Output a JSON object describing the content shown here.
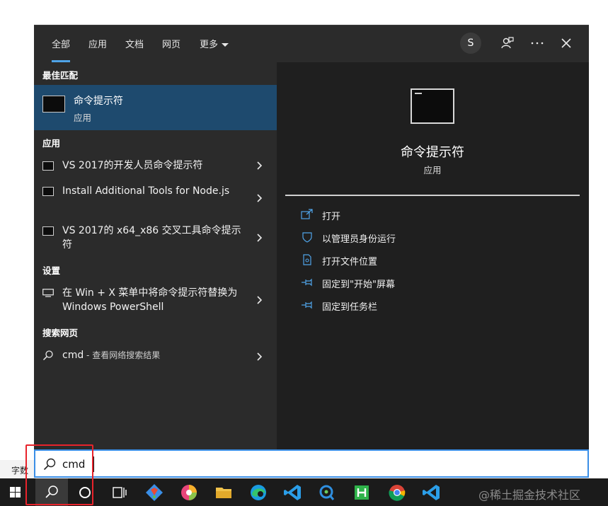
{
  "background": {
    "status_text": "字数"
  },
  "tabs": [
    {
      "label": "全部",
      "active": true
    },
    {
      "label": "应用"
    },
    {
      "label": "文档"
    },
    {
      "label": "网页"
    },
    {
      "label": "更多"
    }
  ],
  "header": {
    "avatar_letter": "S"
  },
  "sections": {
    "best_match": "最佳匹配",
    "apps": "应用",
    "settings": "设置",
    "web": "搜索网页"
  },
  "best_match": {
    "title": "命令提示符",
    "subtitle": "应用"
  },
  "apps": [
    {
      "label": "VS 2017的开发人员命令提示符"
    },
    {
      "label": "Install Additional Tools for Node.js"
    },
    {
      "label": "VS 2017的 x64_x86 交叉工具命令提示符"
    }
  ],
  "settings": [
    {
      "label": "在 Win + X 菜单中将命令提示符替换为 Windows PowerShell"
    }
  ],
  "web": {
    "query": "cmd",
    "suffix": " - 查看网络搜索结果"
  },
  "preview": {
    "title": "命令提示符",
    "subtitle": "应用",
    "actions": [
      {
        "label": "打开",
        "icon": "open-icon"
      },
      {
        "label": "以管理员身份运行",
        "icon": "shield-icon"
      },
      {
        "label": "打开文件位置",
        "icon": "file-location-icon"
      },
      {
        "label": "固定到\"开始\"屏幕",
        "icon": "pin-icon"
      },
      {
        "label": "固定到任务栏",
        "icon": "pin-icon"
      }
    ]
  },
  "search": {
    "value": "cmd"
  },
  "taskbar": {
    "icons": [
      "windows-start-icon",
      "search-icon",
      "cortana-icon",
      "task-view-icon",
      "git-app-icon",
      "chromium-app-icon",
      "file-explorer-icon",
      "edge-icon",
      "vscode-icon",
      "app-icon",
      "hbuilder-icon",
      "chrome-icon",
      "vscode-icon"
    ],
    "watermark": "@稀土掘金技术社区"
  },
  "colors": {
    "accent": "#1e4a6e",
    "highlight": "#e8232b",
    "focus": "#3a8ee6"
  }
}
